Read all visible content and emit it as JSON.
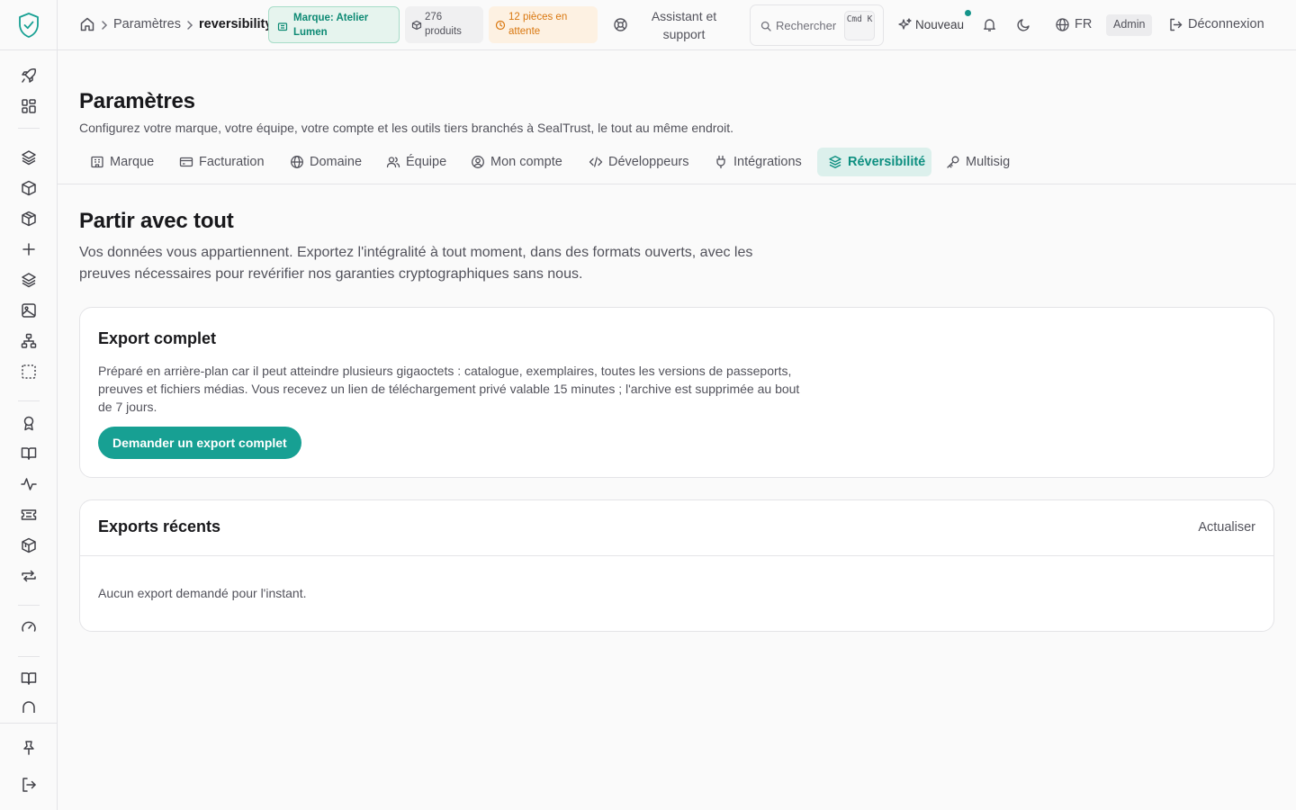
{
  "header": {
    "breadcrumb": {
      "section": "Paramètres",
      "current": "reversibility"
    },
    "badges": {
      "brand": "Marque: Atelier Lumen",
      "products": "276 produits",
      "pending": "12 pièces en attente"
    },
    "support_label": "Assistant et support",
    "search": {
      "placeholder": "Rechercher",
      "shortcut": "Cmd K"
    },
    "new_label": "Nouveau",
    "language": "FR",
    "role": "Admin",
    "logout_label": "Déconnexion"
  },
  "page": {
    "title": "Paramètres",
    "description": "Configurez votre marque, votre équipe, votre compte et les outils tiers branchés à SealTrust, le tout au même endroit."
  },
  "tabs": [
    {
      "label": "Marque",
      "icon": "building-icon"
    },
    {
      "label": "Facturation",
      "icon": "credit-card-icon"
    },
    {
      "label": "Domaine",
      "icon": "globe-icon"
    },
    {
      "label": "Équipe",
      "icon": "users-icon"
    },
    {
      "label": "Mon compte",
      "icon": "user-circle-icon"
    },
    {
      "label": "Développeurs",
      "icon": "code-icon"
    },
    {
      "label": "Intégrations",
      "icon": "plug-icon"
    },
    {
      "label": "Réversibilité",
      "icon": "package-export-icon",
      "active": true
    },
    {
      "label": "Multisig",
      "icon": "key-icon"
    }
  ],
  "section": {
    "title": "Partir avec tout",
    "description": "Vos données vous appartiennent. Exportez l'intégralité à tout moment, dans des formats ouverts, avec les preuves nécessaires pour revérifier nos garanties cryptographiques sans nous."
  },
  "export_card": {
    "title": "Export complet",
    "description": "Préparé en arrière-plan car il peut atteindre plusieurs gigaoctets : catalogue, exemplaires, toutes les versions de passeports, preuves et fichiers médias. Vous recevez un lien de téléchargement privé valable 15 minutes ; l'archive est supprimée au bout de 7 jours.",
    "button_label": "Demander un export complet"
  },
  "recent_card": {
    "title": "Exports récents",
    "refresh_label": "Actualiser",
    "empty_text": "Aucun export demandé pour l'instant."
  },
  "colors": {
    "accent": "#17a093",
    "accent_soft": "#dcf0ec",
    "warning": "#d9770f",
    "border": "#e4e4e7"
  }
}
